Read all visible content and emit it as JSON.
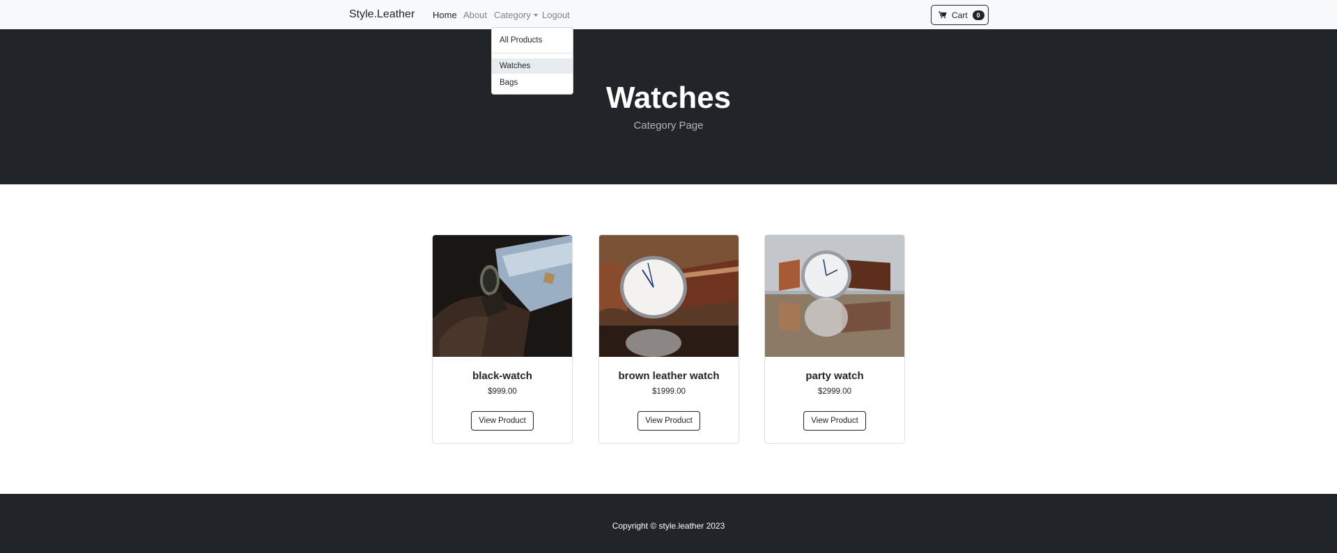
{
  "navbar": {
    "brand": "Style.Leather",
    "links": {
      "home": "Home",
      "about": "About",
      "category": "Category",
      "logout": "Logout"
    },
    "cart": {
      "label": "Cart",
      "count": "0"
    }
  },
  "dropdown": {
    "items": [
      "All Products",
      "Watches",
      "Bags"
    ],
    "highlighted": "Watches"
  },
  "hero": {
    "title": "Watches",
    "subtitle": "Category Page"
  },
  "products": [
    {
      "name": "black-watch",
      "price": "$999.00",
      "button": "View Product"
    },
    {
      "name": "brown leather watch",
      "price": "$1999.00",
      "button": "View Product"
    },
    {
      "name": "party watch",
      "price": "$2999.00",
      "button": "View Product"
    }
  ],
  "footer": {
    "copyright": "Copyright © style.leather 2023"
  },
  "colors": {
    "navbar_bg": "#f8f9fa",
    "dark": "#212529",
    "dropdown_highlight": "#e9ecef"
  }
}
